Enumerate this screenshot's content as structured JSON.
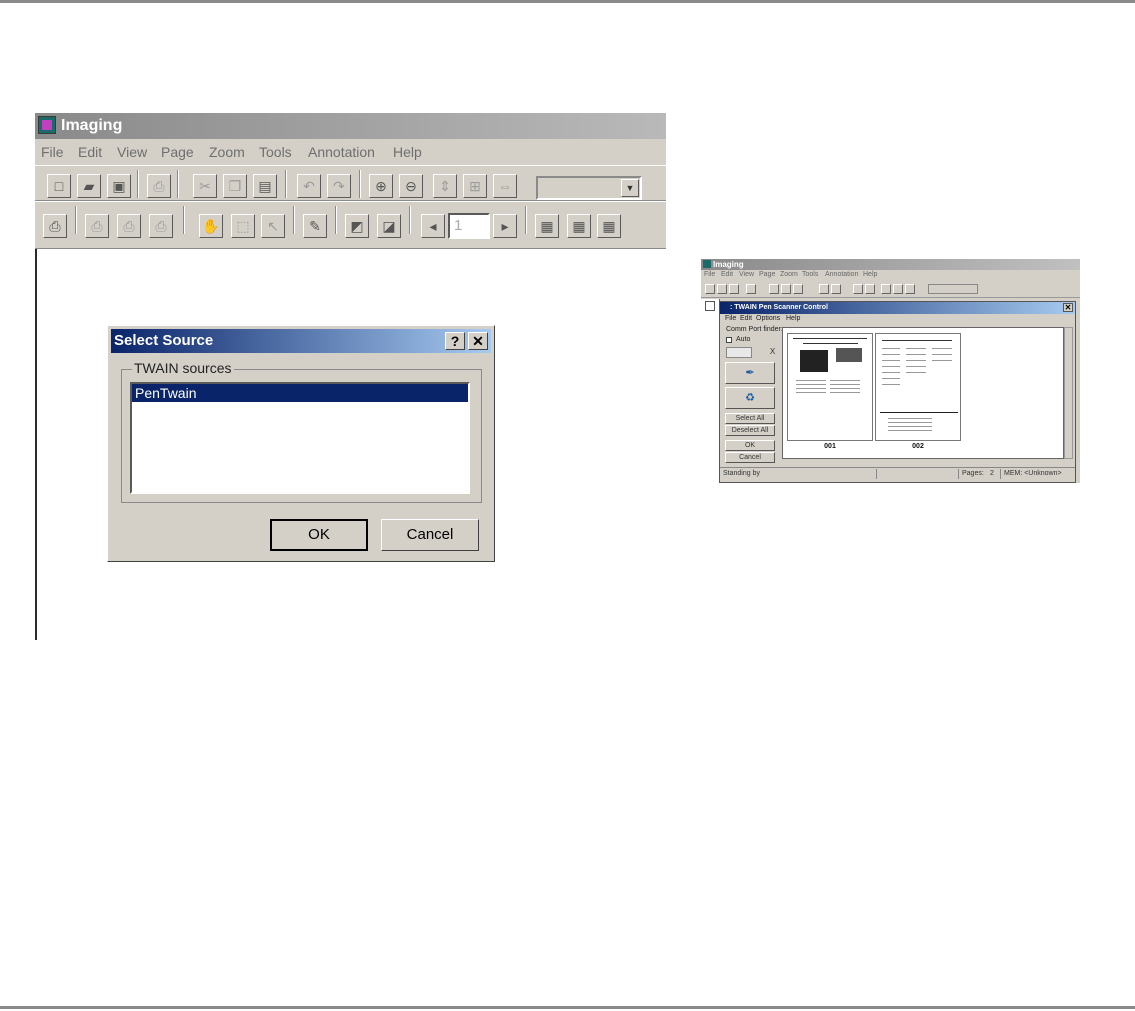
{
  "large_window": {
    "title": "Imaging",
    "menu": [
      "File",
      "Edit",
      "View",
      "Page",
      "Zoom",
      "Tools",
      "Annotation",
      "Help"
    ],
    "toolbar": {
      "page_number": "1",
      "icons": [
        "new-icon",
        "open-icon",
        "save-icon",
        "print-icon",
        "cut-icon",
        "copy-icon",
        "paste-icon",
        "undo-icon",
        "redo-icon",
        "zoom-in-icon",
        "zoom-out-icon",
        "fit-height-icon",
        "best-fit-icon",
        "fit-width-icon",
        "scan-icon",
        "hand-icon",
        "select-icon",
        "pointer-icon",
        "annotation-icon",
        "rotate-icon",
        "thumbnail-icon",
        "prev-page-icon",
        "next-page-icon",
        "view-icon"
      ]
    },
    "dialog": {
      "title": "Select Source",
      "help_label": "?",
      "close_label": "✕",
      "group_label": "TWAIN sources",
      "sources": [
        "PenTwain"
      ],
      "ok_label": "OK",
      "cancel_label": "Cancel"
    }
  },
  "small_window": {
    "title": "Imaging",
    "menu": [
      "File",
      "Edit",
      "View",
      "Page",
      "Zoom",
      "Tools",
      "Annotation",
      "Help"
    ],
    "twain": {
      "title": ": TWAIN Pen Scanner Control",
      "close_label": "✕",
      "menu": [
        "File",
        "Edit",
        "Options",
        "Help"
      ],
      "comm_port_label": "Comm Port finder:",
      "auto_label": "Auto",
      "x_label": "X",
      "select_all_label": "Select All",
      "deselect_all_label": "Deselect All",
      "ok_label": "OK",
      "cancel_label": "Cancel",
      "thumbnails": [
        "001",
        "002"
      ],
      "status": {
        "text": "Standing by",
        "pages_label": "Pages:",
        "pages_value": "2",
        "mem_label": "MEM: <Unknown>"
      }
    }
  }
}
